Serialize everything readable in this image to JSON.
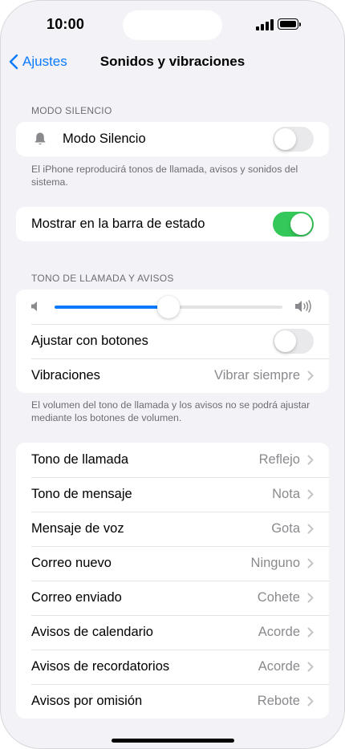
{
  "status_bar": {
    "time": "10:00"
  },
  "nav": {
    "back_label": "Ajustes",
    "title": "Sonidos y vibraciones"
  },
  "silent_section": {
    "header": "MODO SILENCIO",
    "row_label": "Modo Silencio",
    "row_on": false,
    "footer": "El iPhone reproducirá tonos de llamada, avisos y sonidos del sistema."
  },
  "status_section": {
    "row_label": "Mostrar en la barra de estado",
    "row_on": true
  },
  "ringer_section": {
    "header": "TONO DE LLAMADA Y AVISOS",
    "volume_level": 0.5,
    "adjust_label": "Ajustar con botones",
    "adjust_on": false,
    "vibration_label": "Vibraciones",
    "vibration_value": "Vibrar siempre",
    "footer": "El volumen del tono de llamada y los avisos no se podrá ajustar mediante los botones de volumen."
  },
  "sounds": [
    {
      "label": "Tono de llamada",
      "value": "Reflejo"
    },
    {
      "label": "Tono de mensaje",
      "value": "Nota"
    },
    {
      "label": "Mensaje de voz",
      "value": "Gota"
    },
    {
      "label": "Correo nuevo",
      "value": "Ninguno"
    },
    {
      "label": "Correo enviado",
      "value": "Cohete"
    },
    {
      "label": "Avisos de calendario",
      "value": "Acorde"
    },
    {
      "label": "Avisos de recordatorios",
      "value": "Acorde"
    },
    {
      "label": "Avisos por omisión",
      "value": "Rebote"
    }
  ],
  "colors": {
    "accent": "#0a7aff",
    "toggle_on": "#34c759",
    "background": "#f2f2f7"
  }
}
